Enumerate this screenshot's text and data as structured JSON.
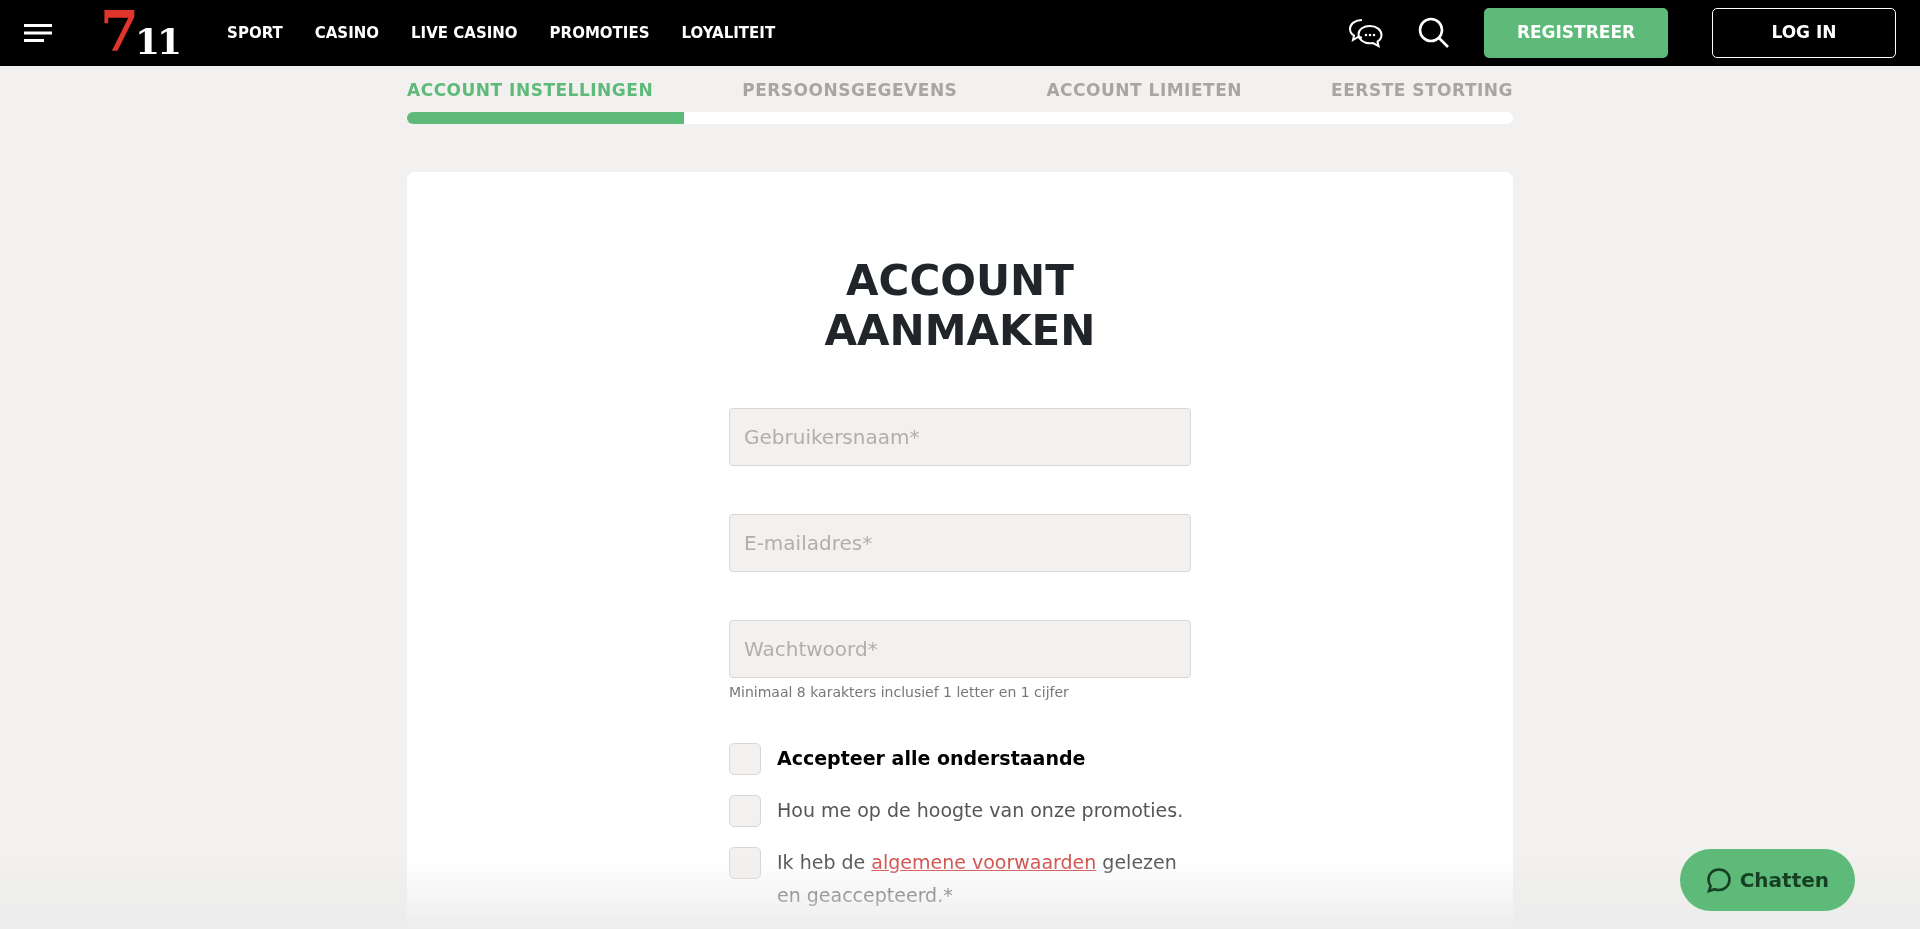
{
  "header": {
    "logo": {
      "digit_big": "7",
      "digits_small": "11"
    },
    "nav": [
      {
        "label": "SPORT"
      },
      {
        "label": "CASINO"
      },
      {
        "label": "LIVE CASINO"
      },
      {
        "label": "PROMOTIES"
      },
      {
        "label": "LOYALITEIT"
      }
    ],
    "buttons": [
      {
        "label": "REGISTREER",
        "kind": "primary"
      },
      {
        "label": "LOG IN",
        "kind": "outline"
      }
    ]
  },
  "steps": [
    {
      "label": "ACCOUNT INSTELLINGEN",
      "selected": true
    },
    {
      "label": "PERSOONSGEGEVENS",
      "selected": false
    },
    {
      "label": "ACCOUNT LIMIETEN",
      "selected": false
    },
    {
      "label": "EERSTE STORTING",
      "selected": false
    }
  ],
  "progress": {
    "level": 0.25
  },
  "form": {
    "title": "ACCOUNT AANMAKEN",
    "fields": [
      {
        "placeholder": "Gebruikersnaam*"
      },
      {
        "placeholder": "E-mailadres*"
      },
      {
        "placeholder": "Wachtwoord*",
        "hint": "Minimaal 8 karakters inclusief 1 letter en 1 cijfer"
      }
    ],
    "checkboxes": [
      {
        "text": "Accepteer alle onderstaande",
        "bold": true,
        "checked": false
      },
      {
        "text": "Hou me op de hoogte van onze promoties.",
        "bold": false,
        "checked": false
      },
      {
        "text": "Ik heb de",
        "link": "algemene voorwaarden",
        "text_after": "gelezen en geaccepteerd.*",
        "bold": false,
        "checked": false
      }
    ]
  },
  "chat_button": {
    "label": "Chatten"
  }
}
